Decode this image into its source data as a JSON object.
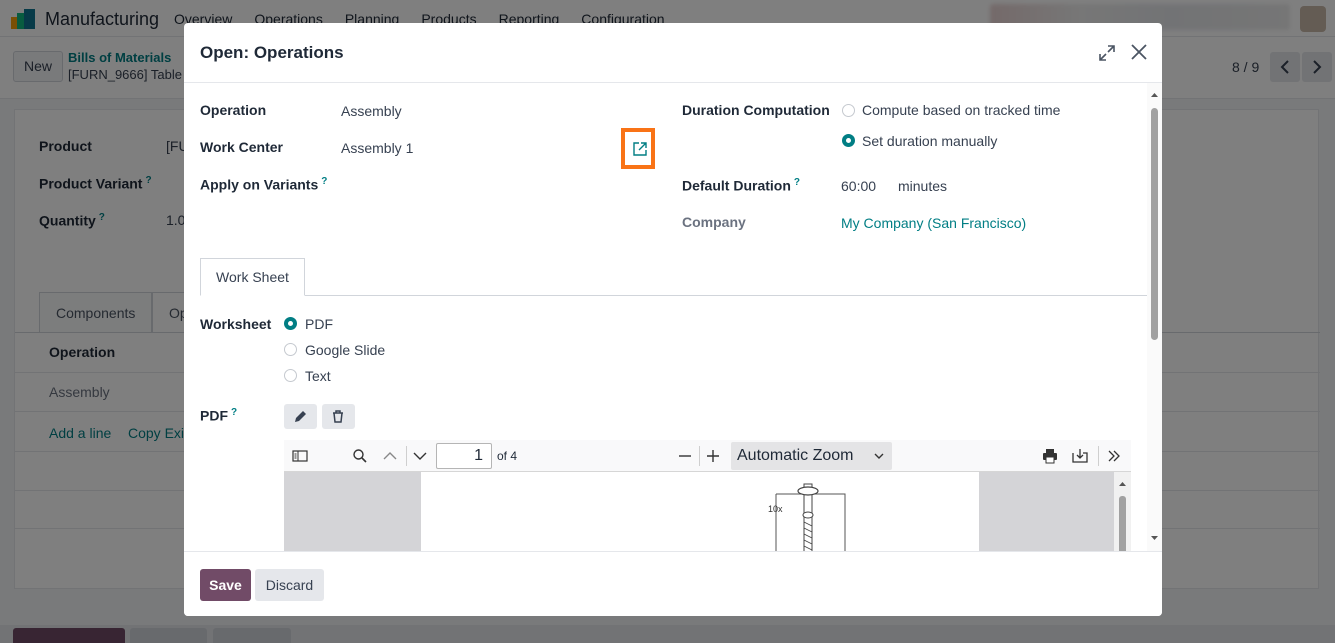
{
  "app": {
    "name": "Manufacturing",
    "menu": [
      "Overview",
      "Operations",
      "Planning",
      "Products",
      "Reporting",
      "Configuration"
    ]
  },
  "control": {
    "new_label": "New",
    "breadcrumb_parent": "Bills of Materials",
    "breadcrumb_current": "[FURN_9666] Table",
    "pager": "8 / 9"
  },
  "background_form": {
    "product_label": "Product",
    "product_value": "[FU",
    "variant_label": "Product Variant",
    "quantity_label": "Quantity",
    "quantity_value": "1.0",
    "tabs": [
      "Components",
      "Op"
    ],
    "column_header": "Operation",
    "row_value": "Assembly",
    "add_line": "Add a line",
    "copy_existing": "Copy Exis"
  },
  "dialog": {
    "title": "Open: Operations",
    "operation_label": "Operation",
    "operation_value": "Assembly",
    "work_center_label": "Work Center",
    "work_center_value": "Assembly 1",
    "apply_variants_label": "Apply on Variants",
    "duration_computation_label": "Duration Computation",
    "duration_options": [
      {
        "label": "Compute based on tracked time",
        "selected": false
      },
      {
        "label": "Set duration manually",
        "selected": true
      }
    ],
    "default_duration_label": "Default Duration",
    "default_duration_value": "60:00",
    "default_duration_unit": "minutes",
    "company_label": "Company",
    "company_value": "My Company (San Francisco)",
    "help_mark": "?",
    "tab_worksheet": "Work Sheet",
    "worksheet_label": "Worksheet",
    "worksheet_options": [
      {
        "label": "PDF",
        "selected": true
      },
      {
        "label": "Google Slide",
        "selected": false
      },
      {
        "label": "Text",
        "selected": false
      }
    ],
    "pdf_label": "PDF",
    "pdf_viewer": {
      "page": "1",
      "of_pages": "of 4",
      "zoom": "Automatic Zoom",
      "page_annotation": "10x"
    },
    "save_label": "Save",
    "discard_label": "Discard"
  },
  "colors": {
    "accent": "#017e84",
    "primary_button": "#714b67",
    "highlight": "#f97316"
  }
}
